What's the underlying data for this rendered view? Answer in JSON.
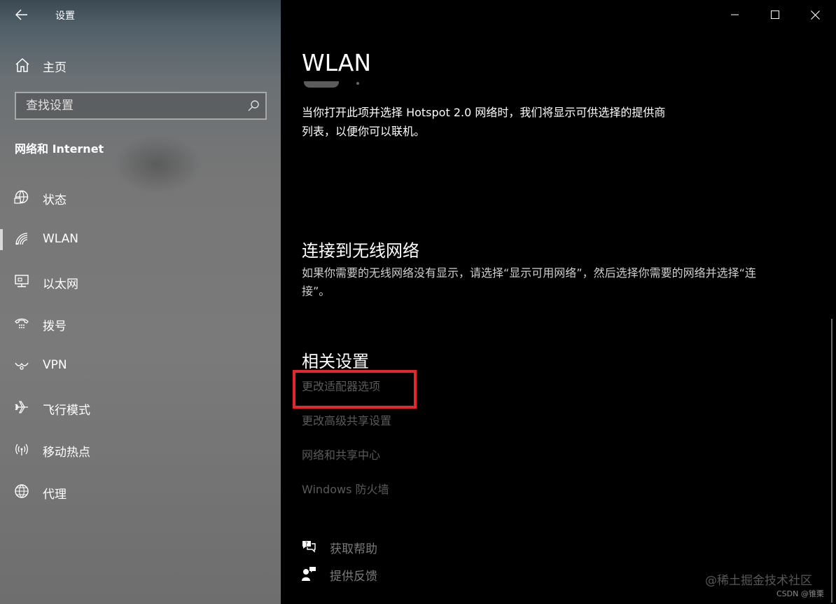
{
  "window": {
    "title": "设置"
  },
  "sidebar": {
    "home_label": "主页",
    "search_placeholder": "查找设置",
    "section_title": "网络和 Internet",
    "items": [
      {
        "label": "状态",
        "icon": "globe-status-icon"
      },
      {
        "label": "WLAN",
        "icon": "wifi-icon",
        "selected": true
      },
      {
        "label": "以太网",
        "icon": "ethernet-icon"
      },
      {
        "label": "拨号",
        "icon": "dialup-icon"
      },
      {
        "label": "VPN",
        "icon": "vpn-icon"
      },
      {
        "label": "飞行模式",
        "icon": "airplane-icon"
      },
      {
        "label": "移动热点",
        "icon": "hotspot-icon"
      },
      {
        "label": "代理",
        "icon": "globe-proxy-icon"
      }
    ]
  },
  "main": {
    "page_title": "WLAN",
    "hotspot_desc_line1": "当你打开此项并选择 Hotspot 2.0 网络时，我们将显示可供选择的提供商",
    "hotspot_desc_line2": "列表，以便你可以联机。",
    "connect_title": "连接到无线网络",
    "connect_desc_line1": "如果你需要的无线网络没有显示，请选择“显示可用网络”，然后选择你需要的网络并选择“连",
    "connect_desc_line2": "接”。",
    "related_title": "相关设置",
    "related_links": [
      "更改适配器选项",
      "更改高级共享设置",
      "网络和共享中心",
      "Windows 防火墙"
    ],
    "help_label": "获取帮助",
    "feedback_label": "提供反馈"
  },
  "watermark": {
    "text": "@稀土掘金技术社区",
    "sub": "CSDN @锥栗"
  },
  "colors": {
    "highlight": "#e6262c",
    "link": "#5a5a5a",
    "main_bg": "#000000"
  }
}
